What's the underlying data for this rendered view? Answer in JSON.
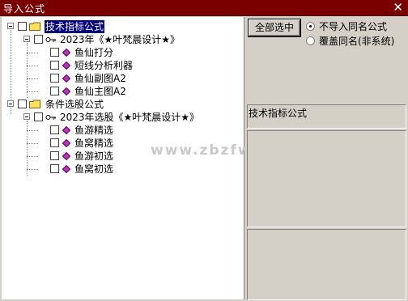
{
  "window": {
    "title": "导入公式",
    "close_glyph": "✕"
  },
  "tree": {
    "root1": {
      "label": "技术指标公式",
      "group": {
        "label": "2023年《★叶梵晨设计★》",
        "items": [
          "鱼仙打分",
          "短线分析利器",
          "鱼仙副图A2",
          "鱼仙主图A2"
        ]
      }
    },
    "root2": {
      "label": "条件选股公式",
      "group": {
        "label": "2023年选股《★叶梵晨设计★》",
        "items": [
          "鱼游精选",
          "鱼窝精选",
          "鱼游初选",
          "鱼窝初选"
        ]
      }
    }
  },
  "watermark": "www.zbzfwu.com",
  "controls": {
    "select_all_label": "全部选中",
    "radio_no_import": "不导入同名公式",
    "radio_overwrite": "覆盖同名(非系统)",
    "selected_radio": "no_import"
  },
  "info_text": "技术指标公式",
  "colors": {
    "titlebar": "#7a0000",
    "selection": "#000080",
    "folder": "#ffe060",
    "gem": "#a020a0"
  }
}
